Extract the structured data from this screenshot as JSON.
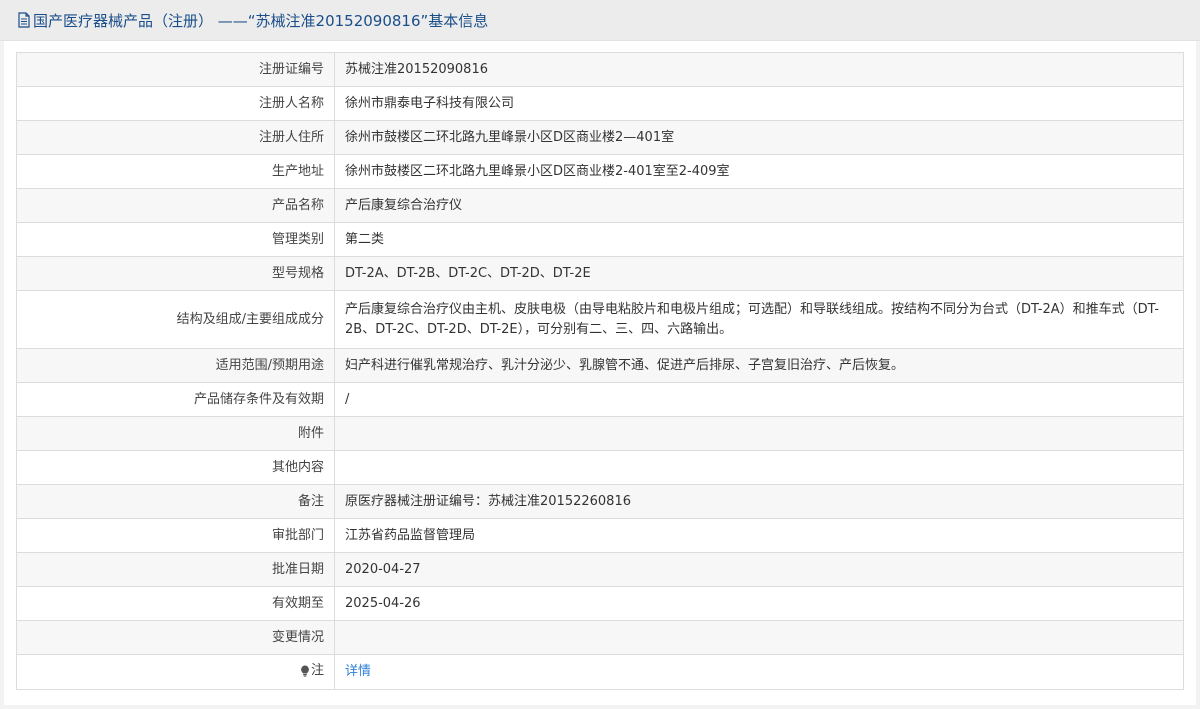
{
  "header": {
    "title": "国产医疗器械产品（注册） ——“苏械注准20152090816”基本信息"
  },
  "rows": [
    {
      "label": "注册证编号",
      "value": "苏械注准20152090816"
    },
    {
      "label": "注册人名称",
      "value": "徐州市鼎泰电子科技有限公司"
    },
    {
      "label": "注册人住所",
      "value": "徐州市鼓楼区二环北路九里峰景小区D区商业楼2—401室"
    },
    {
      "label": "生产地址",
      "value": "徐州市鼓楼区二环北路九里峰景小区D区商业楼2-401室至2-409室"
    },
    {
      "label": "产品名称",
      "value": "产后康复综合治疗仪"
    },
    {
      "label": "管理类别",
      "value": "第二类"
    },
    {
      "label": "型号规格",
      "value": "DT-2A、DT-2B、DT-2C、DT-2D、DT-2E"
    },
    {
      "label": "结构及组成/主要组成成分",
      "value": "产后康复综合治疗仪由主机、皮肤电极（由导电粘胶片和电极片组成；可选配）和导联线组成。按结构不同分为台式（DT-2A）和推车式（DT-2B、DT-2C、DT-2D、DT-2E），可分别有二、三、四、六路输出。"
    },
    {
      "label": "适用范围/预期用途",
      "value": "妇产科进行催乳常规治疗、乳汁分泌少、乳腺管不通、促进产后排尿、子宫复旧治疗、产后恢复。"
    },
    {
      "label": "产品储存条件及有效期",
      "value": "/"
    },
    {
      "label": "附件",
      "value": ""
    },
    {
      "label": "其他内容",
      "value": ""
    },
    {
      "label": "备注",
      "value": "原医疗器械注册证编号：苏械注准20152260816"
    },
    {
      "label": "审批部门",
      "value": "江苏省药品监督管理局"
    },
    {
      "label": "批准日期",
      "value": "2020-04-27"
    },
    {
      "label": "有效期至",
      "value": "2025-04-26"
    },
    {
      "label": "变更情况",
      "value": ""
    }
  ],
  "note_row": {
    "label": "注",
    "link": "详情",
    "icon": "lightbulb-icon"
  },
  "colors": {
    "header_title": "#1a4e8a",
    "link": "#2b7fd8",
    "row_alt": "#f7f7f7",
    "border": "#dcdcdc"
  }
}
